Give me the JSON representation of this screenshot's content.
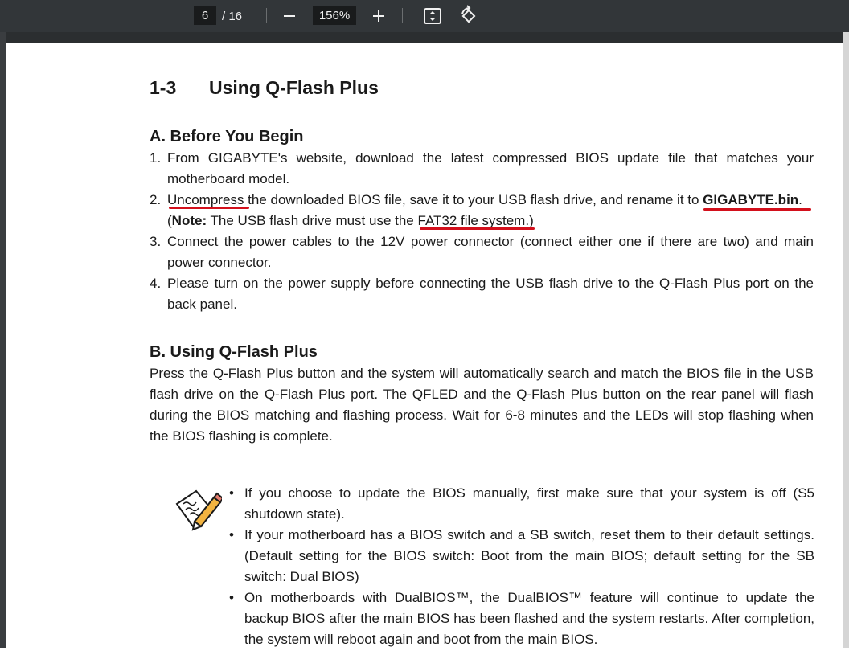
{
  "toolbar": {
    "page_current": "6",
    "page_total": "/ 16",
    "zoom": "156%",
    "icons": [
      "zoom-out-icon",
      "zoom-in-icon",
      "fit-page-icon",
      "rotate-icon"
    ]
  },
  "document": {
    "section_number": "1-3",
    "section_title": "Using Q-Flash Plus",
    "part_a": {
      "heading": "A. Before You Begin",
      "items": [
        {
          "num": "1.",
          "text": "From GIGABYTE's website, download the latest compressed BIOS update file that matches your motherboard model."
        },
        {
          "num": "2.",
          "pre": "Uncompress",
          "mid": " the downloaded BIOS file, save it to your USB flash drive, and rename it to ",
          "bold": "GIGABYTE.bin",
          "post": ".",
          "note_open": "(",
          "note_label": "Note:",
          "note_text": " The USB flash drive must use the ",
          "note_highlight": "FAT32 file system.",
          "note_close": ")"
        },
        {
          "num": "3.",
          "text": "Connect the power cables to the 12V power connector (connect either one if there are two) and main power connector."
        },
        {
          "num": "4.",
          "text": "Please turn on the power supply before connecting the USB flash drive to the Q-Flash Plus port on the back panel."
        }
      ]
    },
    "part_b": {
      "heading": "B. Using Q-Flash Plus",
      "paragraph": "Press the Q-Flash Plus button and the system will automatically search and match the BIOS file in the USB flash drive on the Q-Flash Plus port. The QFLED and the Q-Flash Plus button on the rear panel will flash during the BIOS matching and flashing process. Wait for 6-8 minutes and the LEDs will stop flashing when the BIOS flashing is complete."
    },
    "notes": {
      "icon": "pencil-note-icon",
      "bullet": "•",
      "items": [
        "If you choose to update the BIOS manually, first make sure that your system is off (S5 shutdown state).",
        "If your motherboard has a BIOS switch and a SB switch, reset them to their default settings. (Default setting for the BIOS switch: Boot from the main BIOS; default setting for the SB switch: Dual BIOS)",
        "On motherboards with DualBIOS™, the DualBIOS™ feature will continue to update the backup BIOS after the main BIOS has been flashed and the system restarts. After completion, the system will reboot again and boot from the main BIOS."
      ]
    }
  },
  "colors": {
    "toolbar_bg": "#323639",
    "annotation_red": "#d3101c",
    "text": "#1a1a1a"
  }
}
